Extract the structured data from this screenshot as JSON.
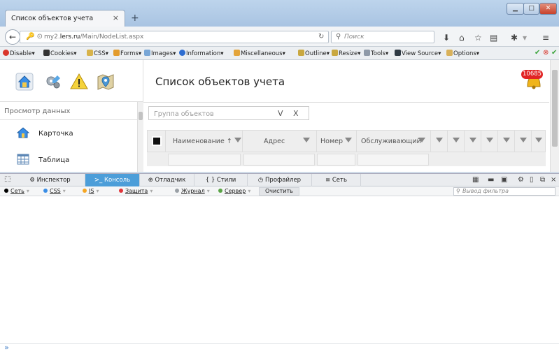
{
  "browser": {
    "tab_title": "Список объектов учета",
    "tab_close": "×",
    "new_tab": "+",
    "window": {
      "minimize": "▁",
      "maximize": "□",
      "close": "✕"
    },
    "url": {
      "prefix": "my2.",
      "host": "lers.ru",
      "path": "/Main/NodeList.aspx"
    },
    "search_placeholder": "Поиск"
  },
  "devbar": {
    "items": [
      "Disable",
      "Cookies",
      "CSS",
      "Forms",
      "Images",
      "Information",
      "Miscellaneous",
      "Outline",
      "Resize",
      "Tools",
      "View Source",
      "Options"
    ]
  },
  "page": {
    "title": "Список объектов учета",
    "notification_count": "10685",
    "sidebar_title": "Просмотр данных",
    "sidebar_items": [
      "Карточка",
      "Таблица"
    ],
    "group_placeholder": "Группа объектов",
    "group_toggle": "V",
    "group_clear": "X",
    "grid": {
      "columns": [
        "Наименование",
        "Адрес",
        "Номер",
        "Обслуживающий"
      ],
      "sort_arrow": "↑"
    }
  },
  "devtools": {
    "tabs": [
      "Инспектор",
      "Консоль",
      "Отладчик",
      "{ } Стили",
      "Профайлер",
      "Сеть"
    ],
    "active_tab": "Консоль",
    "filters": [
      "Сеть",
      "CSS",
      "JS",
      "Защита",
      "Журнал",
      "Сервер"
    ],
    "clear_label": "Очистить",
    "filter_output_placeholder": "Вывод фильтра",
    "prompt": "»"
  },
  "colors": {
    "accent": "#4c9ed9",
    "net": "#000000",
    "css": "#3a8ee6",
    "js": "#f5a623",
    "security": "#e0353a",
    "log": "#9aa0a6",
    "server": "#5aa346"
  }
}
